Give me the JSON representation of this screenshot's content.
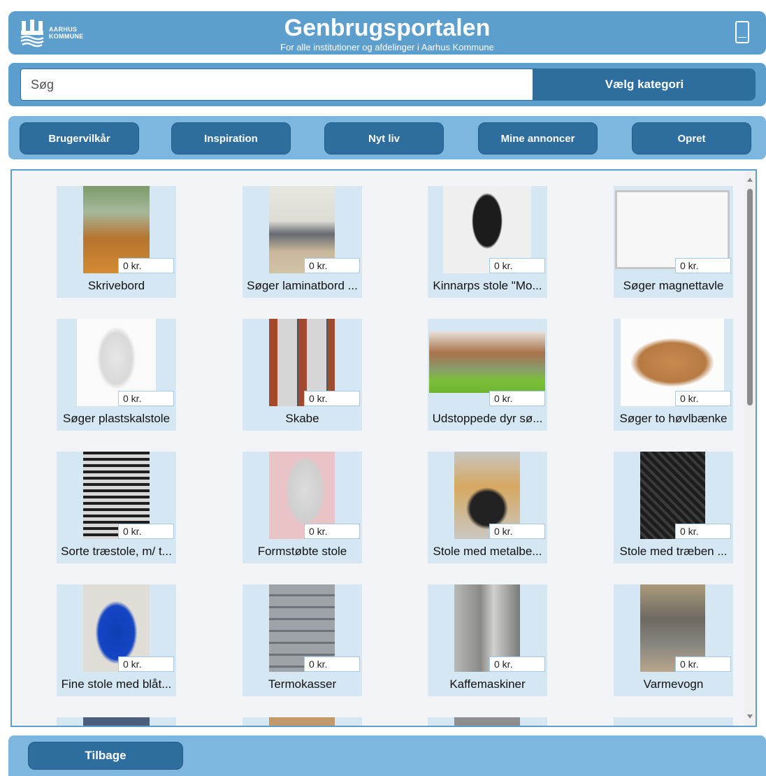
{
  "header": {
    "logo_text_line1": "AARHUS",
    "logo_text_line2": "KOMMUNE",
    "title": "Genbrugsportalen",
    "subtitle": "For alle institutioner og afdelinger i Aarhus Kommune",
    "icon": "phone-icon"
  },
  "search": {
    "placeholder": "Søg",
    "category_button": "Vælg kategori"
  },
  "nav": {
    "items": [
      "Brugervilkår",
      "Inspiration",
      "Nyt liv",
      "Mine annoncer",
      "Opret"
    ]
  },
  "listings": [
    {
      "title": "Skrivebord",
      "price": "0 kr."
    },
    {
      "title": "Søger laminatbord ...",
      "price": "0 kr."
    },
    {
      "title": "Kinnarps stole \"Mo...",
      "price": "0 kr."
    },
    {
      "title": "Søger magnettavle",
      "price": "0 kr."
    },
    {
      "title": "Søger plastskalstole",
      "price": "0 kr."
    },
    {
      "title": "Skabe",
      "price": "0 kr."
    },
    {
      "title": "Udstoppede dyr sø...",
      "price": "0 kr."
    },
    {
      "title": "Søger to høvlbænke",
      "price": "0 kr."
    },
    {
      "title": "Sorte træstole, m/ t...",
      "price": "0 kr."
    },
    {
      "title": "Formstøbte stole",
      "price": "0 kr."
    },
    {
      "title": "Stole med metalbe...",
      "price": "0 kr."
    },
    {
      "title": "Stole med træben ...",
      "price": "0 kr."
    },
    {
      "title": "Fine stole med blåt...",
      "price": "0 kr."
    },
    {
      "title": "Termokasser",
      "price": "0 kr."
    },
    {
      "title": "Kaffemaskiner",
      "price": "0 kr."
    },
    {
      "title": "Varmevogn",
      "price": "0 kr."
    }
  ],
  "footer": {
    "back_label": "Tilbage"
  }
}
